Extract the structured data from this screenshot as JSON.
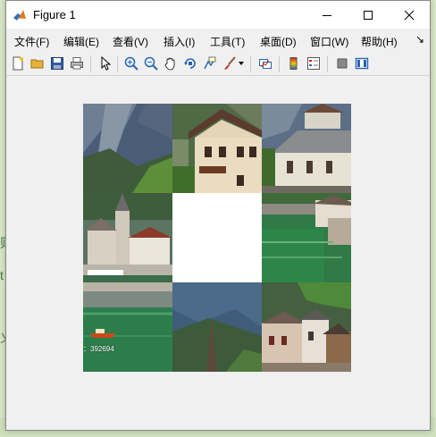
{
  "window": {
    "title": "Figure 1",
    "controls": {
      "minimize": "minimize-icon",
      "maximize": "maximize-icon",
      "close": "close-icon"
    }
  },
  "menu": {
    "items": [
      "文件(F)",
      "编辑(E)",
      "查看(V)",
      "插入(I)",
      "工具(T)",
      "桌面(D)",
      "窗口(W)",
      "帮助(H)"
    ],
    "overflow": "↘"
  },
  "toolbar": {
    "icons": [
      "new-figure-icon",
      "open-file-icon",
      "save-icon",
      "print-icon",
      "edit-plot-arrow-icon",
      "zoom-in-icon",
      "zoom-out-icon",
      "pan-hand-icon",
      "rotate-3d-icon",
      "data-cursor-icon",
      "brush-icon",
      "brush-dropdown-icon",
      "link-plot-icon",
      "colorbar-icon",
      "legend-icon",
      "hide-plot-tools-icon",
      "show-plot-tools-icon"
    ]
  },
  "figure": {
    "puzzle": {
      "grid": "3x3",
      "empty_tile": 4,
      "watermark": "：392694"
    }
  }
}
